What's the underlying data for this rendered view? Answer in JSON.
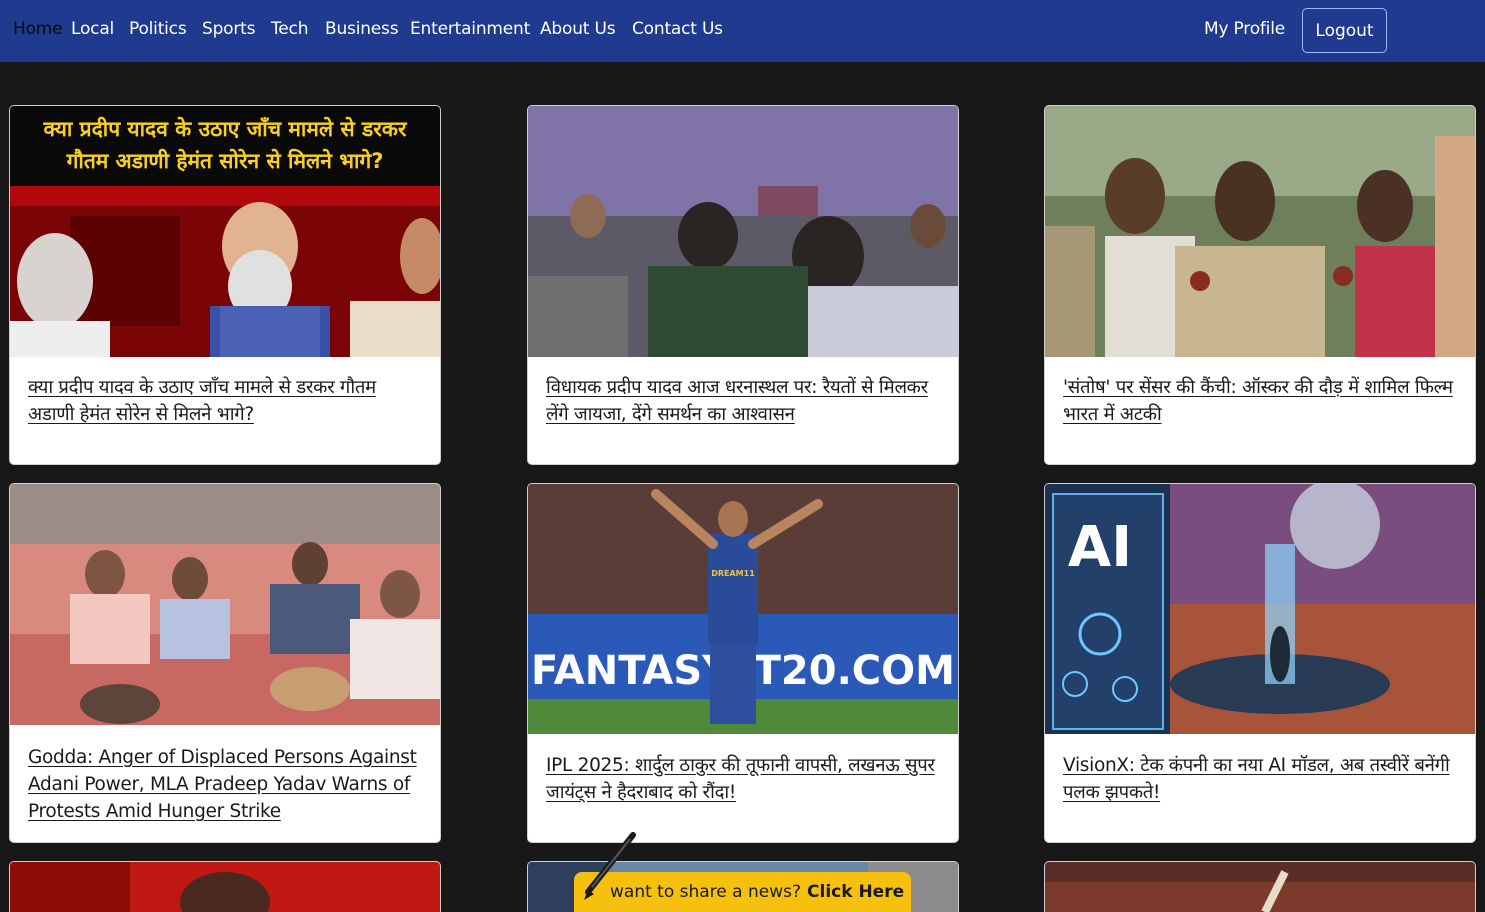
{
  "nav": {
    "items": [
      {
        "label": "Home",
        "active": true
      },
      {
        "label": "Local"
      },
      {
        "label": "Politics"
      },
      {
        "label": "Sports"
      },
      {
        "label": "Tech"
      },
      {
        "label": "Business"
      },
      {
        "label": "Entertainment"
      },
      {
        "label": "About Us"
      },
      {
        "label": "Contact Us"
      }
    ],
    "profile_label": "My Profile",
    "logout_label": "Logout"
  },
  "cards": [
    {
      "title": "क्या प्रदीप यादव के उठाए जाँच मामले से डरकर गौतम अडाणी हेमंत सोरेन से मिलने भागे?",
      "image_caption": "क्या प्रदीप यादव के उठाए जाँच मामले से डरकर गौतम अडाणी हेमंत सोरेन से मिलने भागे?"
    },
    {
      "title": "विधायक प्रदीप यादव आज धरनास्थल पर: रैयतों से मिलकर लेंगे जायजा, देंगे समर्थन का आश्वासन"
    },
    {
      "title": "'संतोष' पर सेंसर की कैंची: ऑस्कर की दौड़ में शामिल फिल्म भारत में अटकी"
    },
    {
      "title": "Godda: Anger of Displaced Persons Against Adani Power, MLA Pradeep Yadav Warns of Protests Amid Hunger Strike"
    },
    {
      "title": "IPL 2025: शार्दुल ठाकुर की तूफानी वापसी, लखनऊ सुपर जायंट्स ने हैदराबाद को रौंदा!",
      "image_text": "FANTASY. T20.COM",
      "jersey_text": "DREAM11"
    },
    {
      "title": "VisionX: टेक कंपनी का नया AI मॉडल, अब तस्वीरें बनेंगी पलक झपकते!",
      "image_text": "AI"
    }
  ],
  "share": {
    "prompt": "want to share a news?",
    "cta": "Click Here"
  },
  "colors": {
    "navbar": "#1f3a8f",
    "background": "#181818",
    "banner": "#f6c10e"
  }
}
